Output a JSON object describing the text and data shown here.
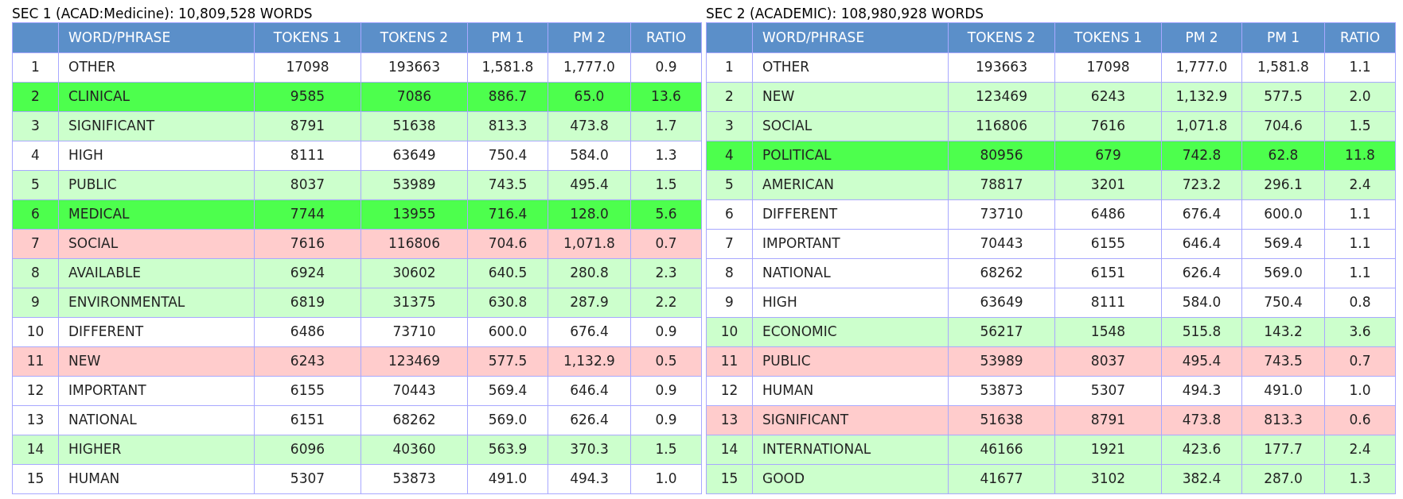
{
  "sections": [
    {
      "title": "SEC 1 (ACAD:Medicine):  10,809,528 WORDS",
      "columns": [
        "",
        "WORD/PHRASE",
        "TOKENS 1",
        "TOKENS 2",
        "PM 1",
        "PM 2",
        "RATIO"
      ],
      "rows": [
        {
          "cells": [
            "1",
            "OTHER",
            "17098",
            "193663",
            "1,581.8",
            "1,777.0",
            "0.9"
          ],
          "color": "#ffffff"
        },
        {
          "cells": [
            "2",
            "CLINICAL",
            "9585",
            "7086",
            "886.7",
            "65.0",
            "13.6"
          ],
          "color": "#4dff4d"
        },
        {
          "cells": [
            "3",
            "SIGNIFICANT",
            "8791",
            "51638",
            "813.3",
            "473.8",
            "1.7"
          ],
          "color": "#ccffcc"
        },
        {
          "cells": [
            "4",
            "HIGH",
            "8111",
            "63649",
            "750.4",
            "584.0",
            "1.3"
          ],
          "color": "#ffffff"
        },
        {
          "cells": [
            "5",
            "PUBLIC",
            "8037",
            "53989",
            "743.5",
            "495.4",
            "1.5"
          ],
          "color": "#ccffcc"
        },
        {
          "cells": [
            "6",
            "MEDICAL",
            "7744",
            "13955",
            "716.4",
            "128.0",
            "5.6"
          ],
          "color": "#4dff4d"
        },
        {
          "cells": [
            "7",
            "SOCIAL",
            "7616",
            "116806",
            "704.6",
            "1,071.8",
            "0.7"
          ],
          "color": "#ffcccc"
        },
        {
          "cells": [
            "8",
            "AVAILABLE",
            "6924",
            "30602",
            "640.5",
            "280.8",
            "2.3"
          ],
          "color": "#ccffcc"
        },
        {
          "cells": [
            "9",
            "ENVIRONMENTAL",
            "6819",
            "31375",
            "630.8",
            "287.9",
            "2.2"
          ],
          "color": "#ccffcc"
        },
        {
          "cells": [
            "10",
            "DIFFERENT",
            "6486",
            "73710",
            "600.0",
            "676.4",
            "0.9"
          ],
          "color": "#ffffff"
        },
        {
          "cells": [
            "11",
            "NEW",
            "6243",
            "123469",
            "577.5",
            "1,132.9",
            "0.5"
          ],
          "color": "#ffcccc"
        },
        {
          "cells": [
            "12",
            "IMPORTANT",
            "6155",
            "70443",
            "569.4",
            "646.4",
            "0.9"
          ],
          "color": "#ffffff"
        },
        {
          "cells": [
            "13",
            "NATIONAL",
            "6151",
            "68262",
            "569.0",
            "626.4",
            "0.9"
          ],
          "color": "#ffffff"
        },
        {
          "cells": [
            "14",
            "HIGHER",
            "6096",
            "40360",
            "563.9",
            "370.3",
            "1.5"
          ],
          "color": "#ccffcc"
        },
        {
          "cells": [
            "15",
            "HUMAN",
            "5307",
            "53873",
            "491.0",
            "494.3",
            "1.0"
          ],
          "color": "#ffffff"
        }
      ]
    },
    {
      "title": "SEC 2 (ACADEMIC):  108,980,928 WORDS",
      "columns": [
        "",
        "WORD/PHRASE",
        "TOKENS 2",
        "TOKENS 1",
        "PM 2",
        "PM 1",
        "RATIO"
      ],
      "rows": [
        {
          "cells": [
            "1",
            "OTHER",
            "193663",
            "17098",
            "1,777.0",
            "1,581.8",
            "1.1"
          ],
          "color": "#ffffff"
        },
        {
          "cells": [
            "2",
            "NEW",
            "123469",
            "6243",
            "1,132.9",
            "577.5",
            "2.0"
          ],
          "color": "#ccffcc"
        },
        {
          "cells": [
            "3",
            "SOCIAL",
            "116806",
            "7616",
            "1,071.8",
            "704.6",
            "1.5"
          ],
          "color": "#ccffcc"
        },
        {
          "cells": [
            "4",
            "POLITICAL",
            "80956",
            "679",
            "742.8",
            "62.8",
            "11.8"
          ],
          "color": "#4dff4d"
        },
        {
          "cells": [
            "5",
            "AMERICAN",
            "78817",
            "3201",
            "723.2",
            "296.1",
            "2.4"
          ],
          "color": "#ccffcc"
        },
        {
          "cells": [
            "6",
            "DIFFERENT",
            "73710",
            "6486",
            "676.4",
            "600.0",
            "1.1"
          ],
          "color": "#ffffff"
        },
        {
          "cells": [
            "7",
            "IMPORTANT",
            "70443",
            "6155",
            "646.4",
            "569.4",
            "1.1"
          ],
          "color": "#ffffff"
        },
        {
          "cells": [
            "8",
            "NATIONAL",
            "68262",
            "6151",
            "626.4",
            "569.0",
            "1.1"
          ],
          "color": "#ffffff"
        },
        {
          "cells": [
            "9",
            "HIGH",
            "63649",
            "8111",
            "584.0",
            "750.4",
            "0.8"
          ],
          "color": "#ffffff"
        },
        {
          "cells": [
            "10",
            "ECONOMIC",
            "56217",
            "1548",
            "515.8",
            "143.2",
            "3.6"
          ],
          "color": "#ccffcc"
        },
        {
          "cells": [
            "11",
            "PUBLIC",
            "53989",
            "8037",
            "495.4",
            "743.5",
            "0.7"
          ],
          "color": "#ffcccc"
        },
        {
          "cells": [
            "12",
            "HUMAN",
            "53873",
            "5307",
            "494.3",
            "491.0",
            "1.0"
          ],
          "color": "#ffffff"
        },
        {
          "cells": [
            "13",
            "SIGNIFICANT",
            "51638",
            "8791",
            "473.8",
            "813.3",
            "0.6"
          ],
          "color": "#ffcccc"
        },
        {
          "cells": [
            "14",
            "INTERNATIONAL",
            "46166",
            "1921",
            "423.6",
            "177.7",
            "2.4"
          ],
          "color": "#ccffcc"
        },
        {
          "cells": [
            "15",
            "GOOD",
            "41677",
            "3102",
            "382.4",
            "287.0",
            "1.3"
          ],
          "color": "#ccffcc"
        }
      ]
    }
  ]
}
